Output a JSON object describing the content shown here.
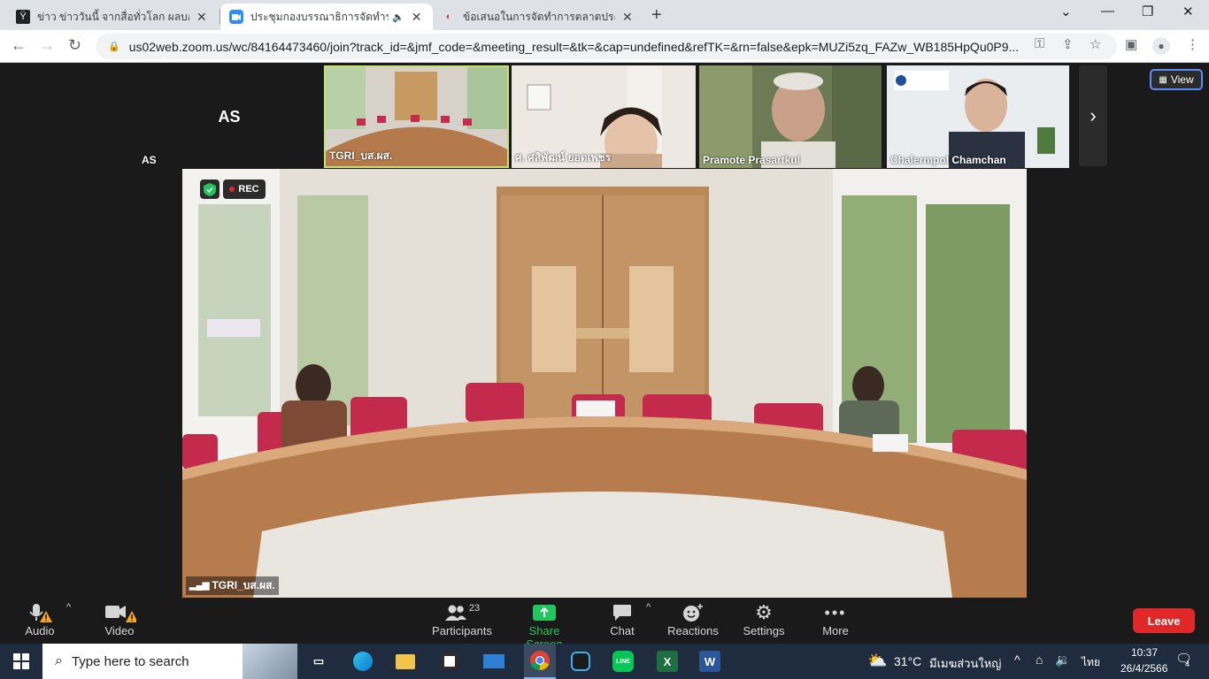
{
  "browser": {
    "tabs": [
      {
        "title": "ข่าว ข่าววันนี้ จากสื่อทั่วโลก ผลบอลโลก"
      },
      {
        "title": "ประชุมกองบรรณาธิการจัดทำราย"
      },
      {
        "title": "ข้อเสนอในการจัดทำการตลาดประมาณปี"
      }
    ],
    "url": "us02web.zoom.us/wc/84164473460/join?track_id=&jmf_code=&meeting_result=&tk=&cap=undefined&refTK=&rn=false&epk=MUZi5zq_FAZw_WB185HpQu0P9..."
  },
  "zoom": {
    "participants": [
      {
        "name": "AS",
        "initials": "AS"
      },
      {
        "name": "TGRI_บส.ผส."
      },
      {
        "name": "ศ. ศสิพัฒน์ ยอดเพชร"
      },
      {
        "name": "Pramote Prasartkul"
      },
      {
        "name": "Chalermpol Chamchan"
      }
    ],
    "view_label": "View",
    "main_speaker": "TGRI_บส.ผส.",
    "rec_label": "REC",
    "controls": {
      "audio": "Audio",
      "video": "Video",
      "participants": "Participants",
      "participants_count": "23",
      "share": "Share Screen",
      "chat": "Chat",
      "reactions": "Reactions",
      "settings": "Settings",
      "more": "More",
      "leave": "Leave"
    },
    "colors": {
      "accent_green": "#22c55e",
      "leave_red": "#e02828",
      "active_border": "#c6e26e"
    }
  },
  "taskbar": {
    "search_placeholder": "Type here to search",
    "weather_temp": "31°C",
    "weather_text": "มีเมฆส่วนใหญ่",
    "lang": "ไทย",
    "time": "10:37",
    "date": "26/4/2566",
    "notification_count": "4"
  }
}
